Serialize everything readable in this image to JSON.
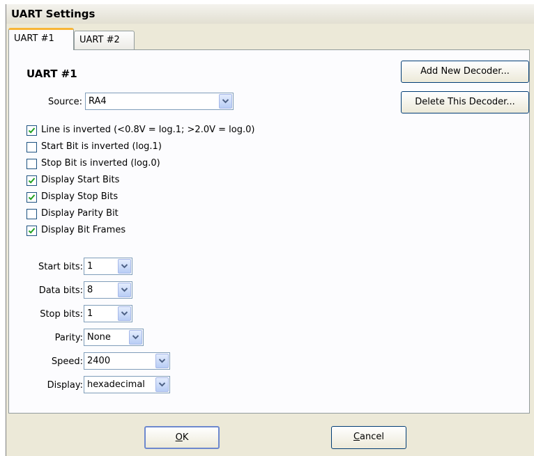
{
  "window": {
    "title": "UART Settings"
  },
  "tabs": [
    {
      "label": "UART #1",
      "active": true
    },
    {
      "label": "UART #2",
      "active": false
    }
  ],
  "panel": {
    "title": "UART #1",
    "add_decoder_label": "Add New Decoder...",
    "delete_decoder_label": "Delete This Decoder...",
    "source": {
      "label": "Source:",
      "value": "RA4"
    },
    "checkboxes": [
      {
        "label": "Line is inverted (<0.8V = log.1; >2.0V = log.0)",
        "checked": true
      },
      {
        "label": "Start Bit is inverted (log.1)",
        "checked": false
      },
      {
        "label": "Stop Bit is inverted (log.0)",
        "checked": false
      },
      {
        "label": "Display Start Bits",
        "checked": true
      },
      {
        "label": "Display Stop Bits",
        "checked": true
      },
      {
        "label": "Display Parity Bit",
        "checked": false
      },
      {
        "label": "Display Bit Frames",
        "checked": true
      }
    ],
    "fields": {
      "start_bits": {
        "label": "Start bits:",
        "value": "1"
      },
      "data_bits": {
        "label": "Data bits:",
        "value": "8"
      },
      "stop_bits": {
        "label": "Stop bits:",
        "value": "1"
      },
      "parity": {
        "label": "Parity:",
        "value": "None"
      },
      "speed": {
        "label": "Speed:",
        "value": "2400"
      },
      "display": {
        "label": "Display:",
        "value": "hexadecimal"
      }
    }
  },
  "footer": {
    "ok_accel": "O",
    "ok_rest": "K",
    "cancel_accel": "C",
    "cancel_rest": "ancel"
  },
  "icons": {
    "dropdown": "chevron-down-icon",
    "check": "checkmark-icon"
  },
  "colors": {
    "accent_tab": "#f8b536",
    "window_bg": "#ece9d8",
    "check": "#21a121"
  }
}
